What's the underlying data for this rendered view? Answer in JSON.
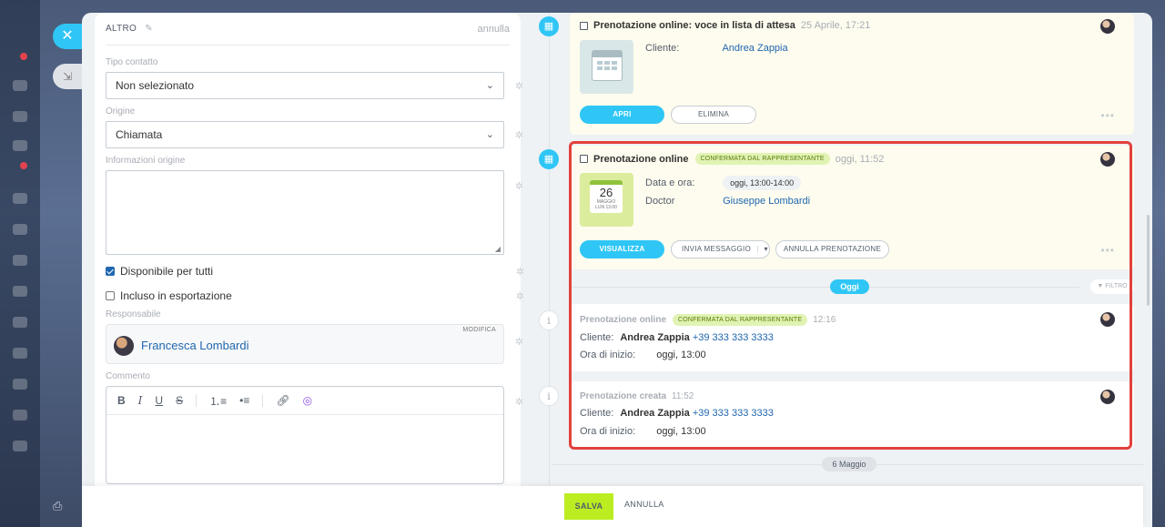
{
  "left_form": {
    "section_title": "ALTRO",
    "cancel_link": "annulla",
    "contact_type": {
      "label": "Tipo contatto",
      "value": "Non selezionato"
    },
    "origin": {
      "label": "Origine",
      "value": "Chiamata"
    },
    "origin_info": {
      "label": "Informazioni origine",
      "value": ""
    },
    "available_all": {
      "label": "Disponibile per tutti",
      "checked": true
    },
    "in_export": {
      "label": "Incluso in esportazione",
      "checked": false
    },
    "responsible": {
      "label": "Responsabile",
      "edit": "MODIFICA",
      "name": "Francesca Lombardi"
    },
    "comment": {
      "label": "Commento"
    }
  },
  "footer": {
    "save": "SALVA",
    "cancel": "ANNULLA"
  },
  "timeline": {
    "waitlist": {
      "title": "Prenotazione online: voce in lista di attesa",
      "time": "25 Aprile, 17:21",
      "client_label": "Cliente:",
      "client_name": "Andrea Zappia",
      "btn_open": "APRI",
      "btn_delete": "ELIMINA"
    },
    "booking": {
      "title": "Prenotazione online",
      "badge": "CONFERMATA DAL RAPPRESENTANTE",
      "time": "oggi, 11:52",
      "cal_day": "26",
      "cal_month": "MAGGIO",
      "cal_sub": "LUN 13:00",
      "date_label": "Data e ora:",
      "date_value": "oggi, 13:00-14:00",
      "doctor_label": "Doctor",
      "doctor_name": "Giuseppe Lombardi",
      "btn_view": "VISUALIZZA",
      "btn_message": "INVIA MESSAGGIO",
      "btn_cancel": "ANNULLA PRENOTAZIONE"
    },
    "today_label": "Oggi",
    "filter_label": "FILTRO",
    "event1": {
      "title": "Prenotazione online",
      "badge": "CONFERMATA DAL RAPPRESENTANTE",
      "time": "12:16",
      "client_label": "Cliente:",
      "client_name": "Andrea Zappia",
      "phone": "+39 333 333 3333",
      "start_label": "Ora di inizio:",
      "start_value": "oggi, 13:00"
    },
    "event2": {
      "title": "Prenotazione creata",
      "time": "11:52",
      "client_label": "Cliente:",
      "client_name": "Andrea Zappia",
      "phone": "+39 333 333 3333",
      "start_label": "Ora di inizio:",
      "start_value": "oggi, 13:00"
    },
    "date_divider": "6 Maggio"
  },
  "colors": {
    "accent": "#2fc6f6",
    "save": "#bbed21",
    "highlight": "#e2413c",
    "link": "#2067b0"
  }
}
